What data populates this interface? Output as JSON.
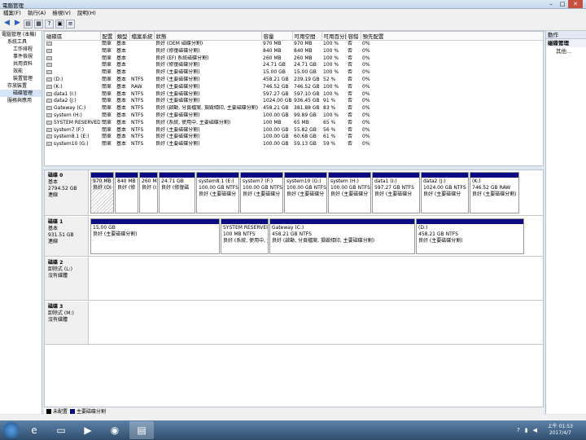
{
  "window": {
    "title": "電腦管理"
  },
  "menu": [
    "檔案(F)",
    "執行(A)",
    "檢視(V)",
    "說明(H)"
  ],
  "tree": [
    {
      "label": "電腦管理 (本機)",
      "indent": 0
    },
    {
      "label": "系統工具",
      "indent": 1
    },
    {
      "label": "工作排程",
      "indent": 2
    },
    {
      "label": "事件檢視",
      "indent": 2
    },
    {
      "label": "共用資料",
      "indent": 2
    },
    {
      "label": "效能",
      "indent": 2
    },
    {
      "label": "裝置管理",
      "indent": 2
    },
    {
      "label": "存放裝置",
      "indent": 1
    },
    {
      "label": "磁碟管理",
      "indent": 2,
      "selected": true
    },
    {
      "label": "服務與應用",
      "indent": 1
    }
  ],
  "volume_table": {
    "headers": [
      "磁碟區",
      "配置",
      "類型",
      "檔案系統",
      "狀態",
      "容量",
      "可用空間",
      "可用百分比",
      "容錯",
      "預先配置"
    ],
    "rows": [
      [
        "",
        "簡單",
        "基本",
        "",
        "良好 (OEM 磁碟分割)",
        "970 MB",
        "970 MB",
        "100 %",
        "否",
        "0%"
      ],
      [
        "",
        "簡單",
        "基本",
        "",
        "良好 (修復磁碟分割)",
        "840 MB",
        "840 MB",
        "100 %",
        "否",
        "0%"
      ],
      [
        "",
        "簡單",
        "基本",
        "",
        "良好 (EFI 系統磁碟分割)",
        "260 MB",
        "260 MB",
        "100 %",
        "否",
        "0%"
      ],
      [
        "",
        "簡單",
        "基本",
        "",
        "良好 (修復磁碟分割)",
        "24.71 GB",
        "24.71 GB",
        "100 %",
        "否",
        "0%"
      ],
      [
        "",
        "簡單",
        "基本",
        "",
        "良好 (主要磁碟分割)",
        "15.00 GB",
        "15.00 GB",
        "100 %",
        "否",
        "0%"
      ],
      [
        "(D:)",
        "簡單",
        "基本",
        "NTFS",
        "良好 (主要磁碟分割)",
        "458.21 GB",
        "239.19 GB",
        "52 %",
        "否",
        "0%"
      ],
      [
        "(K:)",
        "簡單",
        "基本",
        "RAW",
        "良好 (主要磁碟分割)",
        "746.52 GB",
        "746.52 GB",
        "100 %",
        "否",
        "0%"
      ],
      [
        "data1 (I:)",
        "簡單",
        "基本",
        "NTFS",
        "良好 (主要磁碟分割)",
        "597.27 GB",
        "597.10 GB",
        "100 %",
        "否",
        "0%"
      ],
      [
        "data2 (J:)",
        "簡單",
        "基本",
        "NTFS",
        "良好 (主要磁碟分割)",
        "1024.00 GB",
        "936.45 GB",
        "91 %",
        "否",
        "0%"
      ],
      [
        "Gateway (C:)",
        "簡單",
        "基本",
        "NTFS",
        "良好 (啟動, 分頁檔案, 損毀傾印, 主要磁碟分割)",
        "458.21 GB",
        "381.88 GB",
        "83 %",
        "否",
        "0%"
      ],
      [
        "system (H:)",
        "簡單",
        "基本",
        "NTFS",
        "良好 (主要磁碟分割)",
        "100.00 GB",
        "99.89 GB",
        "100 %",
        "否",
        "0%"
      ],
      [
        "SYSTEM RESERVED",
        "簡單",
        "基本",
        "NTFS",
        "良好 (系統, 使用中, 主要磁碟分割)",
        "100 MB",
        "65 MB",
        "65 %",
        "否",
        "0%"
      ],
      [
        "system7 (F:)",
        "簡單",
        "基本",
        "NTFS",
        "良好 (主要磁碟分割)",
        "100.00 GB",
        "55.82 GB",
        "56 %",
        "否",
        "0%"
      ],
      [
        "system8.1 (E:)",
        "簡單",
        "基本",
        "NTFS",
        "良好 (主要磁碟分割)",
        "100.00 GB",
        "60.68 GB",
        "61 %",
        "否",
        "0%"
      ],
      [
        "system10 (G:)",
        "簡單",
        "基本",
        "NTFS",
        "良好 (主要磁碟分割)",
        "100.00 GB",
        "59.13 GB",
        "59 %",
        "否",
        "0%"
      ]
    ]
  },
  "disks": [
    {
      "name": "磁碟 0",
      "type": "基本",
      "size": "2794.52 GB",
      "status": "連線",
      "partitions": [
        {
          "name": "",
          "size": "970 MB",
          "status": "良好 (OI",
          "hatch": true
        },
        {
          "name": "",
          "size": "840 MB",
          "status": "良好 (修"
        },
        {
          "name": "",
          "size": "260 M",
          "status": "良好 (I"
        },
        {
          "name": "",
          "size": "24.71 GB",
          "status": "良好 (修復磁"
        },
        {
          "name": "system8.1 (E:)",
          "size": "100.00 GB NTFS",
          "status": "良好 (主要磁碟分"
        },
        {
          "name": "system7 (F:)",
          "size": "100.00 GB NTFS",
          "status": "良好 (主要磁碟分"
        },
        {
          "name": "system10 (G:)",
          "size": "100.00 GB NTFS",
          "status": "良好 (主要磁碟分"
        },
        {
          "name": "system (H:)",
          "size": "100.00 GB NTFS",
          "status": "良好 (主要磁碟分"
        },
        {
          "name": "data1 (I:)",
          "size": "597.27 GB NTFS",
          "status": "良好 (主要磁碟分"
        },
        {
          "name": "data2 (J:)",
          "size": "1024.00 GB NTFS",
          "status": "良好 (主要磁碟分"
        },
        {
          "name": "(K:)",
          "size": "746.52 GB RAW",
          "status": "良好 (主要磁碟分割)"
        }
      ]
    },
    {
      "name": "磁碟 1",
      "type": "基本",
      "size": "931.51 GB",
      "status": "連線",
      "partitions": [
        {
          "name": "",
          "size": "15.00 GB",
          "status": "良好 (主要磁碟分割)"
        },
        {
          "name": "SYSTEM RESERVEI",
          "size": "100 MB NTFS",
          "status": "良好 (系統, 使用中, 主"
        },
        {
          "name": "Gateway (C:)",
          "size": "458.21 GB NTFS",
          "status": "良好 (啟動, 分頁檔案, 損毀傾印, 主要磁碟分割)"
        },
        {
          "name": "(D:)",
          "size": "458.21 GB NTFS",
          "status": "良好 (主要磁碟分割)"
        }
      ]
    },
    {
      "name": "磁碟 2",
      "type": "卸除式 (L:)",
      "size": "",
      "status": "沒有媒體",
      "partitions": []
    },
    {
      "name": "磁碟 3",
      "type": "卸除式 (M:)",
      "size": "",
      "status": "沒有媒體",
      "partitions": []
    }
  ],
  "legend": [
    {
      "label": "未配置",
      "color": "#000000"
    },
    {
      "label": "主要磁碟分割",
      "color": "#0a0a82"
    }
  ],
  "actions": {
    "header": "動作",
    "section": "磁碟管理",
    "more": "其他..."
  },
  "taskbar": {
    "time": "上午 01:53",
    "date": "2017/4/7"
  }
}
